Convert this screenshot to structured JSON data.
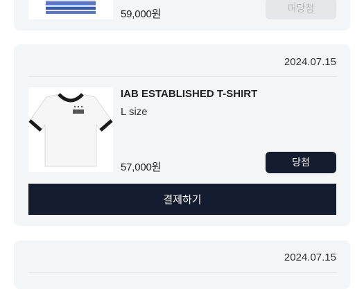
{
  "items": [
    {
      "price": "59,000원",
      "status_label": "미당첨"
    },
    {
      "date": "2024.07.15",
      "product_name": "IAB ESTABLISHED T-SHIRT",
      "option": "L size",
      "price": "57,000원",
      "status_label": "당첨",
      "pay_label": "결제하기"
    },
    {
      "date": "2024.07.15"
    }
  ]
}
